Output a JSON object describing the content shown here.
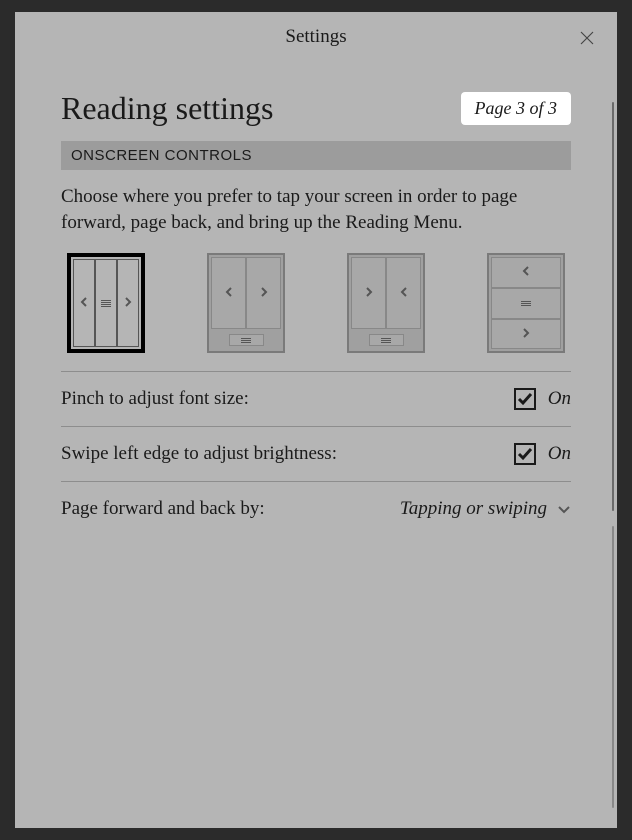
{
  "modal_title": "Settings",
  "page_title": "Reading settings",
  "page_indicator": "Page 3 of 3",
  "section_header": "ONSCREEN CONTROLS",
  "instruction": "Choose where you prefer to tap your screen in order to page forward, page back, and bring up the Reading Menu.",
  "settings": {
    "pinch": {
      "label": "Pinch to adjust font size:",
      "value": "On"
    },
    "swipe": {
      "label": "Swipe left edge to adjust brightness:",
      "value": "On"
    },
    "page_method": {
      "label": "Page forward and back by:",
      "value": "Tapping or swiping"
    }
  }
}
